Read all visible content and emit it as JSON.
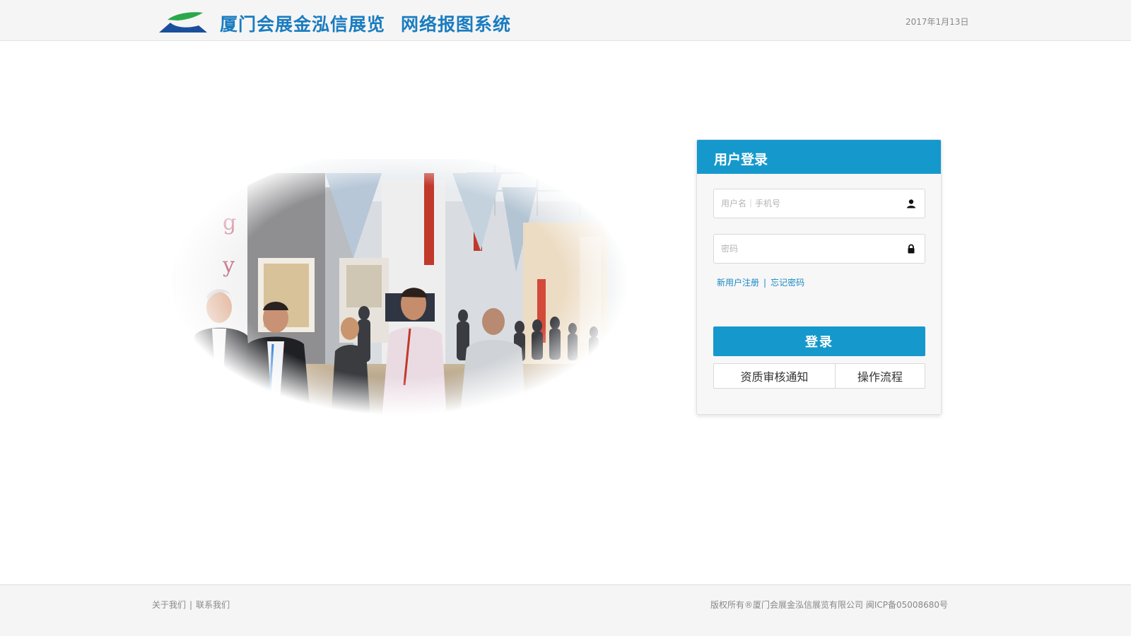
{
  "header": {
    "title": "厦门会展金泓信展览",
    "subtitle": "网络报图系统",
    "date": "2017年1月13日"
  },
  "login": {
    "heading": "用户登录",
    "username_placeholder": "用户名｜手机号",
    "password_placeholder": "密码",
    "register_link": "新用户注册",
    "link_separator": "|",
    "forgot_link": "忘记密码",
    "submit_label": "登录",
    "notice_button": "资质审核通知",
    "flow_button": "操作流程"
  },
  "footer": {
    "about_link": "关于我们",
    "separator": "|",
    "contact_link": "联系我们",
    "copyright": "版权所有®厦门会展金泓信展览有限公司 闽ICP备05008680号"
  },
  "colors": {
    "brand_blue": "#1599cc",
    "title_blue": "#1a7cc0",
    "logo_green": "#2aa84a",
    "logo_navy": "#1b4f9c"
  },
  "icons": {
    "logo": "company-logo",
    "user": "user-icon",
    "lock": "lock-icon"
  }
}
